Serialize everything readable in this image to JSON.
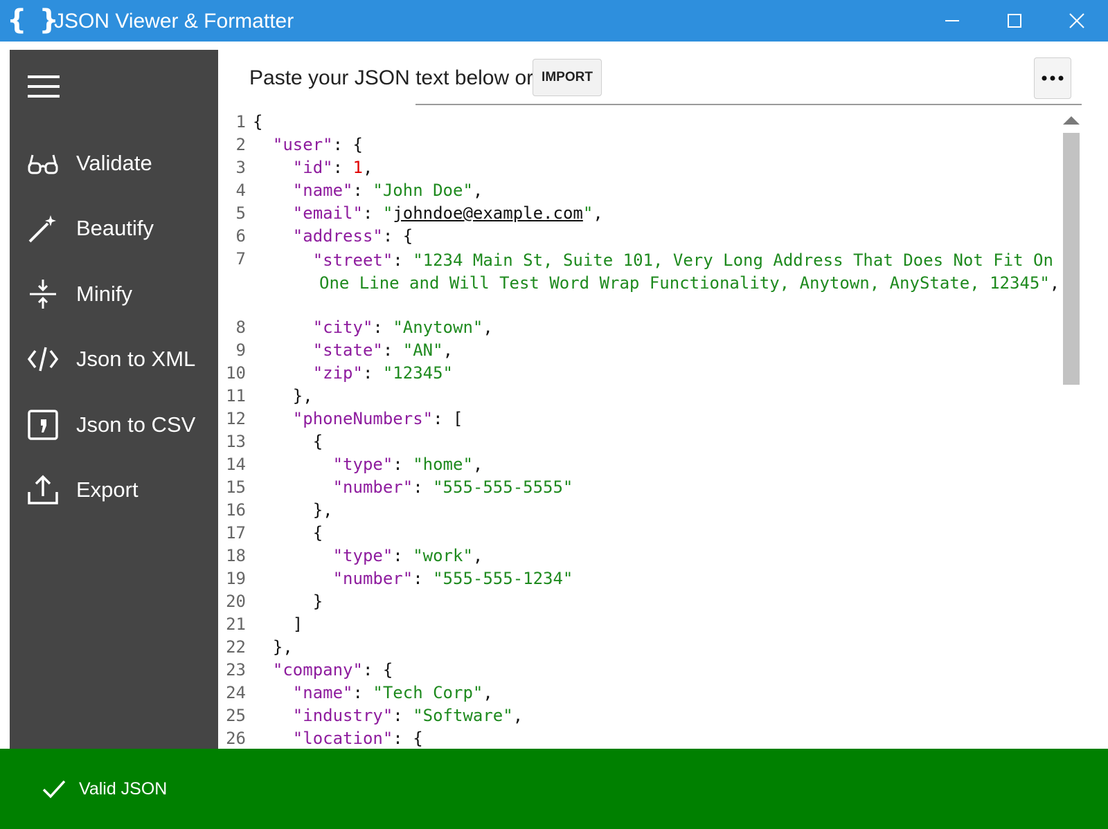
{
  "window": {
    "app_icon_glyph": "{ }",
    "title": "JSON Viewer & Formatter",
    "minimize_glyph": "—",
    "maximize_glyph": "☐",
    "close_glyph": "✕"
  },
  "sidebar": {
    "items": [
      {
        "label": "Validate",
        "icon": "glasses-icon"
      },
      {
        "label": "Beautify",
        "icon": "magic-wand-icon"
      },
      {
        "label": "Minify",
        "icon": "compress-icon"
      },
      {
        "label": "Json to XML",
        "icon": "code-icon"
      },
      {
        "label": "Json to CSV",
        "icon": "comma-box-icon"
      },
      {
        "label": "Export",
        "icon": "upload-icon"
      }
    ]
  },
  "toolbar": {
    "prompt_text": "Paste your JSON text below or",
    "import_label": "IMPORT",
    "more_glyph": "···"
  },
  "editor": {
    "line_numbers": [
      "1",
      "2",
      "3",
      "4",
      "5",
      "6",
      "7",
      "8",
      "9",
      "10",
      "11",
      "12",
      "13",
      "14",
      "15",
      "16",
      "17",
      "18",
      "19",
      "20",
      "21",
      "22",
      "23",
      "24",
      "25",
      "26"
    ],
    "lines": [
      "{",
      "  \"user\": {",
      "    \"id\": 1,",
      "    \"name\": \"John Doe\",",
      "    \"email\": \"johndoe@example.com\",",
      "    \"address\": {",
      "      \"street\": \"1234 Main St, Suite 101, Very Long Address That Does Not Fit On One Line and Will Test Word Wrap Functionality, Anytown, AnyState, 12345\",",
      "      \"city\": \"Anytown\",",
      "      \"state\": \"AN\",",
      "      \"zip\": \"12345\"",
      "    },",
      "    \"phoneNumbers\": [",
      "      {",
      "        \"type\": \"home\",",
      "        \"number\": \"555-555-5555\"",
      "      },",
      "      {",
      "        \"type\": \"work\",",
      "        \"number\": \"555-555-1234\"",
      "      }",
      "    ]",
      "  },",
      "  \"company\": {",
      "    \"name\": \"Tech Corp\",",
      "    \"industry\": \"Software\",",
      "    \"location\": {"
    ],
    "colors": {
      "key": "#8e1c9e",
      "string": "#1e8a1e",
      "number": "#e00000"
    }
  },
  "status": {
    "text": "Valid JSON",
    "icon": "checkmark-icon",
    "color": "#008000"
  },
  "colors": {
    "titlebar": "#2e8fdd",
    "sidebar": "#454545"
  }
}
